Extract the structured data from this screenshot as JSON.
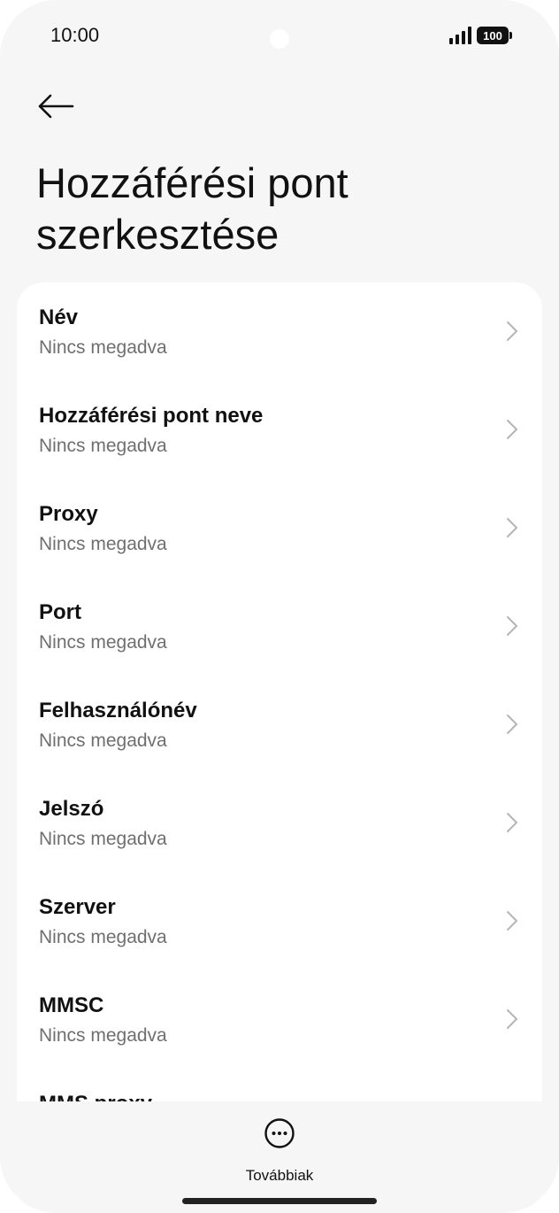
{
  "status_bar": {
    "time": "10:00",
    "battery": "100"
  },
  "header": {
    "title": "Hozzáférési pont szerkesztése"
  },
  "items": [
    {
      "label": "Név",
      "value": "Nincs megadva"
    },
    {
      "label": "Hozzáférési pont neve",
      "value": "Nincs megadva"
    },
    {
      "label": "Proxy",
      "value": "Nincs megadva"
    },
    {
      "label": "Port",
      "value": "Nincs megadva"
    },
    {
      "label": "Felhasználónév",
      "value": "Nincs megadva"
    },
    {
      "label": "Jelszó",
      "value": "Nincs megadva"
    },
    {
      "label": "Szerver",
      "value": "Nincs megadva"
    },
    {
      "label": "MMSC",
      "value": "Nincs megadva"
    },
    {
      "label": "MMS proxy",
      "value": ""
    }
  ],
  "bottom_bar": {
    "more_label": "Továbbiak"
  },
  "icons": {
    "back": "arrow-left-icon",
    "chevron": "chevron-right-icon",
    "more": "more-horizontal-circle-icon"
  },
  "colors": {
    "background": "#f6f6f6",
    "card": "#ffffff",
    "subtitle": "#6f6f6f",
    "chevron": "#b5b5b5"
  }
}
